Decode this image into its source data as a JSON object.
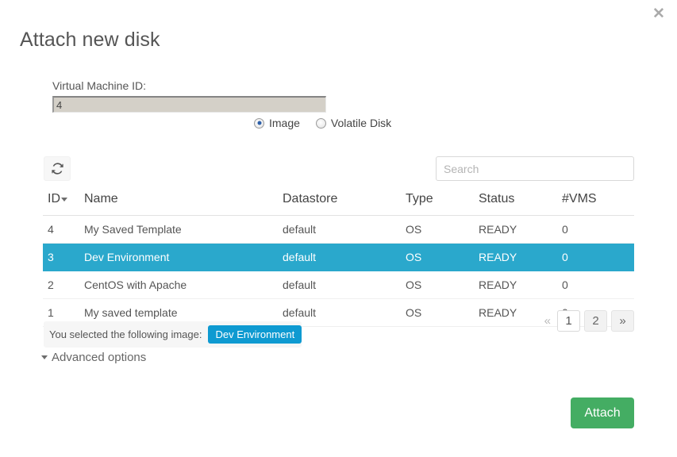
{
  "modal": {
    "title": "Attach new disk",
    "close_icon": "close-icon"
  },
  "form": {
    "vmid_label": "Virtual Machine ID:",
    "vmid_value": "4",
    "vmid_placeholder": "",
    "disk_type_options": [
      {
        "label": "Image",
        "checked": true
      },
      {
        "label": "Volatile Disk",
        "checked": false
      }
    ]
  },
  "toolbar": {
    "refresh_icon": "refresh-icon",
    "search_placeholder": "Search",
    "search_value": ""
  },
  "table": {
    "columns": [
      "ID",
      "Name",
      "Datastore",
      "Type",
      "Status",
      "#VMS"
    ],
    "sort_column": "ID",
    "sort_direction": "desc",
    "rows": [
      {
        "id": "4",
        "name": "My Saved Template",
        "datastore": "default",
        "type": "OS",
        "status": "READY",
        "vms": "0",
        "selected": false
      },
      {
        "id": "3",
        "name": "Dev Environment",
        "datastore": "default",
        "type": "OS",
        "status": "READY",
        "vms": "0",
        "selected": true
      },
      {
        "id": "2",
        "name": "CentOS with Apache",
        "datastore": "default",
        "type": "OS",
        "status": "READY",
        "vms": "0",
        "selected": false
      },
      {
        "id": "1",
        "name": "My saved template",
        "datastore": "default",
        "type": "OS",
        "status": "READY",
        "vms": "0",
        "selected": false
      }
    ]
  },
  "selection": {
    "label": "You selected the following image:",
    "badge": "Dev Environment"
  },
  "pagination": {
    "prev": "«",
    "next": "»",
    "pages": [
      "1",
      "2"
    ],
    "active_page": "1"
  },
  "advanced": {
    "label": "Advanced options",
    "expanded": true
  },
  "footer": {
    "attach_label": "Attach"
  },
  "colors": {
    "row_selected": "#2aa8cc",
    "badge": "#0e9ad1",
    "attach_button": "#44ad63",
    "title_text": "#555555"
  }
}
